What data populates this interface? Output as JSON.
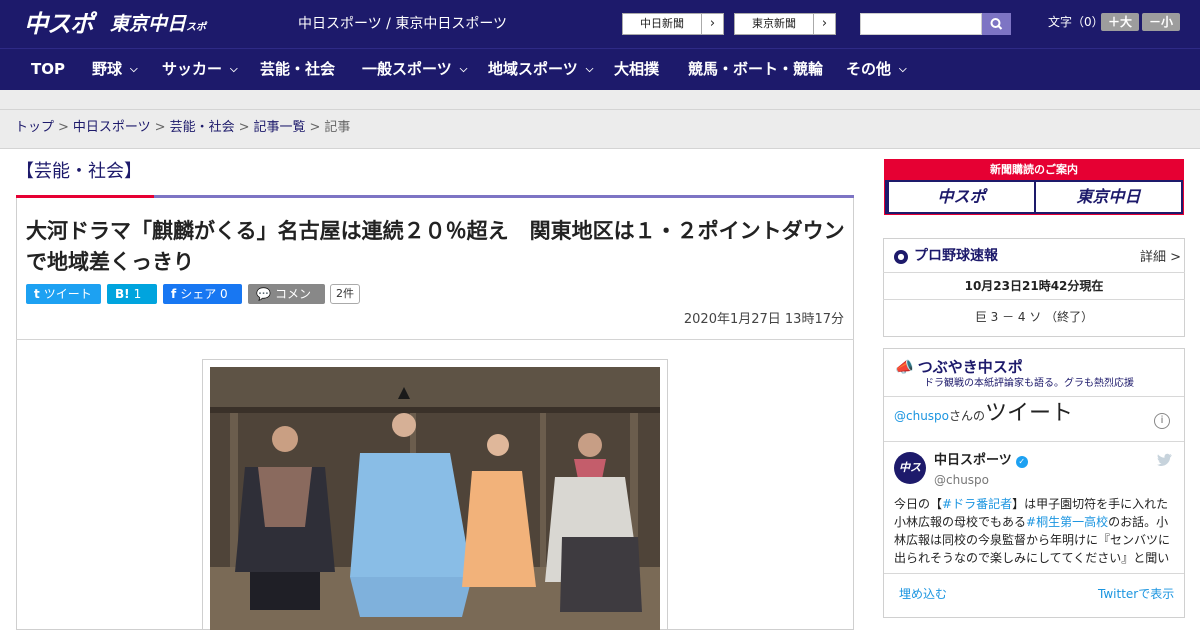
{
  "header": {
    "logo_chuspo": "中スポ",
    "logo_tokyo": "東京中日",
    "logo_tokyo_small": "スポーツ",
    "site_name": "中日スポーツ / 東京中日スポーツ",
    "ext_links": [
      {
        "label": "中日新聞",
        "arrow": "›"
      },
      {
        "label": "東京新聞",
        "arrow": "›"
      }
    ],
    "search": {
      "value": "",
      "placeholder": ""
    },
    "fontsize_label": "文字（0）",
    "fontsize_larger": "＋大",
    "fontsize_smaller": "－小"
  },
  "nav": {
    "items": [
      {
        "label": "TOP",
        "chevron": ""
      },
      {
        "label": "野球",
        "chevron": "⌵"
      },
      {
        "label": "サッカー",
        "chevron": "⌵"
      },
      {
        "label": "芸能・社会",
        "chevron": ""
      },
      {
        "label": "一般スポーツ",
        "chevron": "⌵"
      },
      {
        "label": "地域スポーツ",
        "chevron": "⌵"
      },
      {
        "label": "大相撲",
        "chevron": ""
      },
      {
        "label": "競馬・ボート・競輪",
        "chevron": ""
      },
      {
        "label": "その他",
        "chevron": "⌵"
      }
    ]
  },
  "breadcrumb": {
    "items": [
      "トップ",
      "中日スポーツ",
      "芸能・社会",
      "記事一覧"
    ],
    "current": "記事",
    "separator": ">"
  },
  "article": {
    "category": "【芸能・社会】",
    "headline": "大河ドラマ「麒麟がくる」名古屋は連続２０％超え　関東地区は１・２ポイントダウンで地域差くっきり",
    "share": {
      "tweet_icon": "t",
      "tweet_label": "ツイート",
      "hatena_icon": "B!",
      "hatena_count": "1",
      "facebook_icon": "f",
      "facebook_label": "シェア 0",
      "comment_icon": "💬",
      "comment_label": "コメント",
      "comment_count": "2件"
    },
    "date": "2020年1月27日 13時17分"
  },
  "sidebar": {
    "ad": {
      "title": "新聞購読のご案内",
      "left": "中スポ",
      "right": "東京中日"
    },
    "baseball": {
      "title": "プロ野球速報",
      "detail_link": "詳細 >",
      "as_of": "10月23日21時42分現在",
      "score": "巨 3 － 4 ソ （終了）"
    },
    "twitter": {
      "title": "つぶやき中スポ",
      "subtitle": "ドラ観戦の本紙評論家も語る。グラも熱烈応援",
      "handle_link": "@chuspo",
      "san_no": "さんの",
      "tweets_label": "ツイート",
      "info_icon": "i",
      "account_name": "中日スポーツ",
      "verified_icon": "✓",
      "account_handle": "@chuspo",
      "avatar_text": "中スポ",
      "tweet_part1": "今日の【",
      "tweet_tag1": "#ドラ番記者",
      "tweet_part2": "】は甲子園切符を手に入れた小林広報の母校でもある",
      "tweet_tag2": "#桐生第一高校",
      "tweet_part3": "のお話。小林広報は同校の今泉監督から年明けに『センバツに出られそうなので楽しみにしててください』と聞い",
      "embed_label": "埋め込む",
      "view_label": "Twitterで表示"
    }
  },
  "colors": {
    "brand": "#1d1a6b",
    "accent_red": "#e60033",
    "accent_purple": "#7d74c4",
    "twitter_blue": "#1b95e0"
  }
}
